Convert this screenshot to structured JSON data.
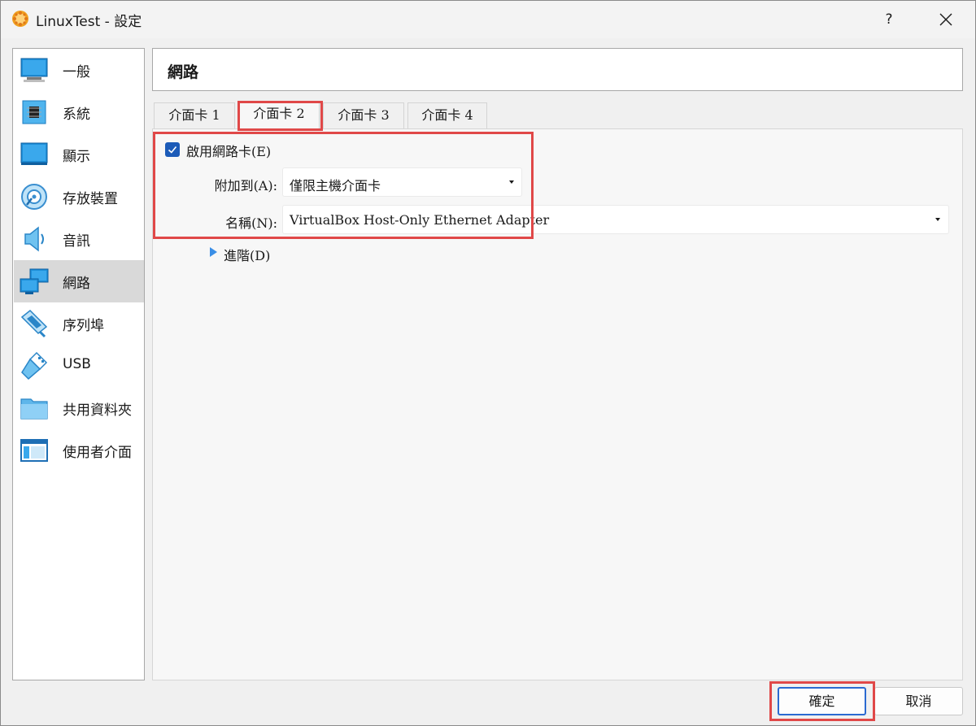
{
  "window": {
    "title": "LinuxTest - 設定",
    "help_label": "?"
  },
  "sidebar": {
    "items": [
      {
        "label": "一般",
        "icon": "monitor-icon"
      },
      {
        "label": "系統",
        "icon": "chip-icon"
      },
      {
        "label": "顯示",
        "icon": "display-icon"
      },
      {
        "label": "存放裝置",
        "icon": "disk-icon"
      },
      {
        "label": "音訊",
        "icon": "speaker-icon"
      },
      {
        "label": "網路",
        "icon": "network-icon",
        "selected": true
      },
      {
        "label": "序列埠",
        "icon": "serial-port-icon"
      },
      {
        "label": "USB",
        "icon": "usb-icon"
      },
      {
        "label": "共用資料夾",
        "icon": "folder-icon"
      },
      {
        "label": "使用者介面",
        "icon": "window-layout-icon"
      }
    ]
  },
  "page": {
    "title": "網路"
  },
  "tabs": [
    {
      "label": "介面卡 1",
      "active": false
    },
    {
      "label": "介面卡 2",
      "active": true
    },
    {
      "label": "介面卡 3",
      "active": false
    },
    {
      "label": "介面卡 4",
      "active": false
    }
  ],
  "adapter": {
    "enable_label": "啟用網路卡(E)",
    "enable_checked": true,
    "attached_label": "附加到(A):",
    "attached_value": "僅限主機介面卡",
    "name_label": "名稱(N):",
    "name_value": "VirtualBox Host-Only Ethernet Adapter",
    "advanced_label": "進階(D)"
  },
  "buttons": {
    "ok": "確定",
    "cancel": "取消"
  },
  "colors": {
    "highlight": "#e04848",
    "accent": "#1c5bb8",
    "selected_bg": "#d9d9d9"
  }
}
